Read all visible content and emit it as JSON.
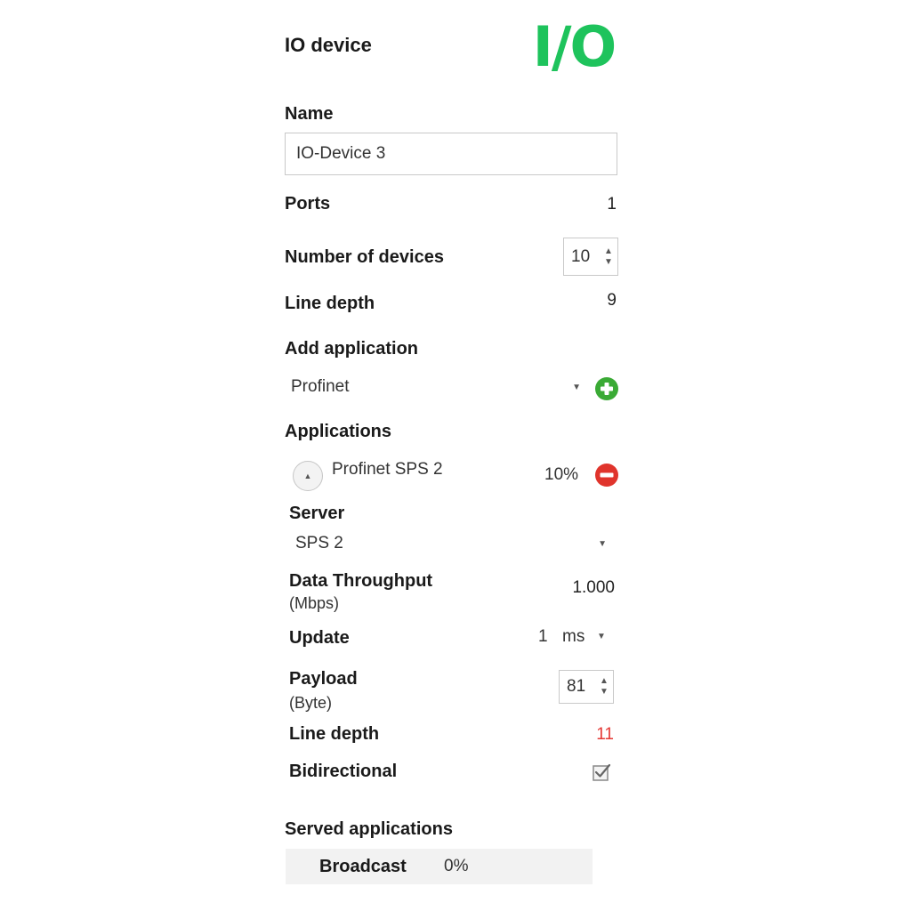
{
  "panel": {
    "title": "IO device",
    "logo_text": "I/O",
    "logo_color": "#1ec35c"
  },
  "name": {
    "label": "Name",
    "value": "IO-Device 3"
  },
  "ports": {
    "label": "Ports",
    "value": "1"
  },
  "number_of_devices": {
    "label": "Number of devices",
    "value": "10"
  },
  "line_depth": {
    "label": "Line depth",
    "value": "9"
  },
  "add_application": {
    "label": "Add application",
    "selected": "Profinet",
    "add_icon": "plus-circle-icon",
    "add_icon_color": "#3aaa35"
  },
  "applications": {
    "label": "Applications",
    "items": [
      {
        "name": "Profinet SPS 2",
        "share": "10%",
        "remove_icon": "minus-circle-icon",
        "remove_icon_color": "#e0342c",
        "server": {
          "label": "Server",
          "selected": "SPS 2"
        },
        "data_throughput": {
          "label": "Data Throughput",
          "unit": "(Mbps)",
          "value": "1.000"
        },
        "update": {
          "label": "Update",
          "value": "1",
          "unit": "ms"
        },
        "payload": {
          "label": "Payload",
          "unit": "(Byte)",
          "value": "81"
        },
        "line_depth": {
          "label": "Line depth",
          "value": "11",
          "color": "#e53935"
        },
        "bidirectional": {
          "label": "Bidirectional",
          "checked": true
        }
      }
    ]
  },
  "served_applications": {
    "label": "Served applications",
    "rows": [
      {
        "name": "Broadcast",
        "share": "0%"
      }
    ]
  }
}
